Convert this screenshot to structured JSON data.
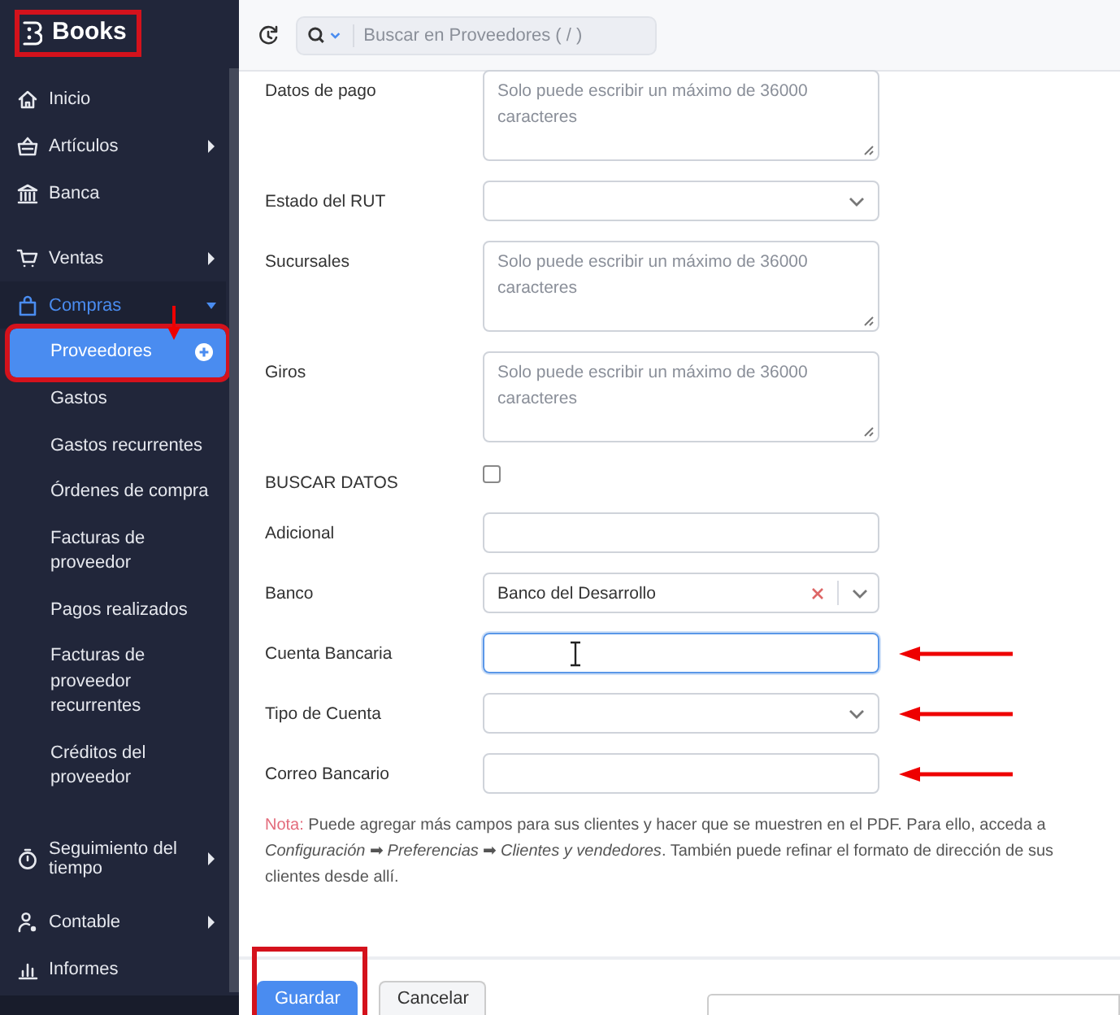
{
  "sidebar": {
    "brand": "Books",
    "brand_highlighted": true,
    "items": [
      {
        "label": "Inicio"
      },
      {
        "label": "Artículos",
        "expanded": false
      },
      {
        "label": "Banca"
      },
      {
        "label": "Ventas",
        "expanded": false
      },
      {
        "label": "Compras",
        "expanded": true,
        "children": [
          {
            "label": "Proveedores",
            "selected": true,
            "highlighted": true
          },
          {
            "label": "Gastos",
            "selected": false,
            "highlighted": false
          },
          {
            "label": "Gastos recurrentes",
            "selected": false,
            "highlighted": false
          },
          {
            "label": "Órdenes de compra",
            "selected": false,
            "highlighted": false
          },
          {
            "label": "Facturas de proveedor",
            "selected": false,
            "highlighted": false
          },
          {
            "label": "Pagos realizados",
            "selected": false,
            "highlighted": false
          },
          {
            "label": "Facturas de proveedor recurrentes",
            "selected": false,
            "highlighted": false
          },
          {
            "label": "Créditos del proveedor",
            "selected": false,
            "highlighted": false
          }
        ]
      },
      {
        "label": "Seguimiento del tiempo",
        "expanded": false
      },
      {
        "label": "Contable",
        "expanded": false
      },
      {
        "label": "Informes"
      }
    ]
  },
  "search": {
    "placeholder": "Buscar en Proveedores ( / )"
  },
  "form": {
    "fields": [
      {
        "label": "Datos de pago",
        "kind": "textarea",
        "placeholder": "Solo puede escribir un máximo de 36000 caracteres",
        "annotated": false
      },
      {
        "label": "Estado del RUT",
        "kind": "select",
        "annotated": false
      },
      {
        "label": "Sucursales",
        "kind": "textarea",
        "placeholder": "Solo puede escribir un máximo de 36000 caracteres",
        "annotated": false
      },
      {
        "label": "Giros",
        "kind": "textarea",
        "placeholder": "Solo puede escribir un máximo de 36000 caracteres",
        "annotated": false
      },
      {
        "label": "BUSCAR DATOS",
        "kind": "checkbox",
        "checked": false,
        "annotated": false
      },
      {
        "label": "Adicional",
        "kind": "input",
        "focused": false,
        "annotated": false
      },
      {
        "label": "Banco",
        "kind": "combo",
        "value": "Banco del Desarrollo",
        "annotated": false
      },
      {
        "label": "Cuenta Bancaria",
        "kind": "input",
        "focused": true,
        "annotated": true
      },
      {
        "label": "Tipo de Cuenta",
        "kind": "select",
        "annotated": true
      },
      {
        "label": "Correo Bancario",
        "kind": "input",
        "focused": false,
        "annotated": true
      }
    ],
    "note": {
      "label": "Nota:",
      "text": "Puede agregar más campos para sus clientes y hacer que se muestren en el PDF. Para ello, acceda a *Configuración* ➡ *Preferencias* ➡ *Clientes y vendedores*. También puede refinar el formato de dirección de sus clientes desde allí."
    }
  },
  "footer": {
    "buttons": [
      {
        "label": "Guardar",
        "kind": "primary",
        "highlighted": true
      },
      {
        "label": "Cancelar",
        "kind": "secondary",
        "highlighted": false
      }
    ]
  }
}
